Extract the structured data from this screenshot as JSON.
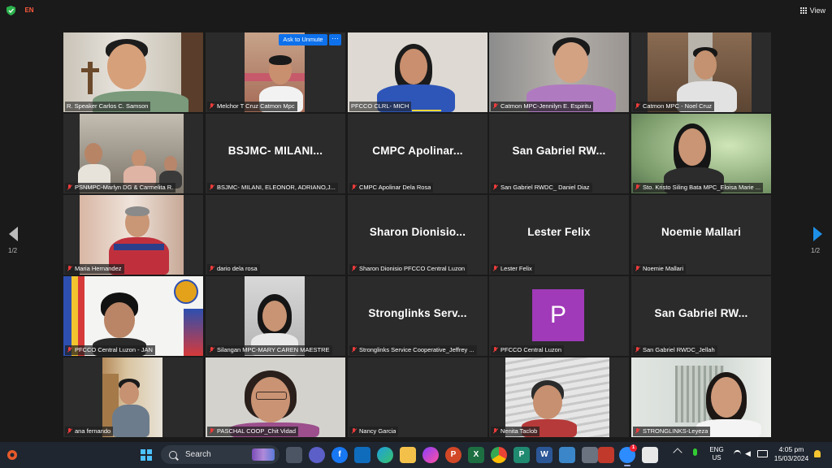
{
  "topbar": {
    "lang_badge": "EN",
    "view_label": "View",
    "icons": [
      "shield-check-icon",
      "grid-view-icon"
    ]
  },
  "meeting": {
    "ask_to_unmute": "Ask to Unmute",
    "more_options": "···",
    "page_left": "1/2",
    "page_right": "1/2",
    "tiles": [
      {
        "label": "R. Speaker Carlos C. Samson",
        "muted": false,
        "display_name": "",
        "video": true
      },
      {
        "label": "Melchor T Cruz Catmon Mpc",
        "muted": true,
        "display_name": "",
        "video": true
      },
      {
        "label": "PFCCO CLRL- MICH",
        "muted": false,
        "display_name": "",
        "video": true
      },
      {
        "label": "Catmon MPC-Jennilyn E. Espiritu",
        "muted": true,
        "display_name": "",
        "video": true
      },
      {
        "label": "Catmon MPC - Noel Cruz",
        "muted": true,
        "display_name": "",
        "video": true
      },
      {
        "label": "PSNMPC-Marlyn DG & Carmelita R.",
        "muted": true,
        "display_name": "",
        "video": true
      },
      {
        "label": "BSJMC- MILANI, ELEONOR, ADRIANO,J...",
        "muted": true,
        "display_name": "BSJMC-  MILANI...",
        "video": false
      },
      {
        "label": "CMPC Apolinar Dela Rosa",
        "muted": true,
        "display_name": "CMPC  Apolinar...",
        "video": false
      },
      {
        "label": "San Gabriel RWDC_ Daniel Diaz",
        "muted": true,
        "display_name": "San  Gabriel  RW...",
        "video": false
      },
      {
        "label": "Sto. Kristo Siling Bata MPC_Eloisa Marie ...",
        "muted": true,
        "display_name": "",
        "video": true
      },
      {
        "label": "Maria Hernandez",
        "muted": true,
        "display_name": "",
        "video": true
      },
      {
        "label": "dario dela rosa",
        "muted": true,
        "display_name": "",
        "video": false
      },
      {
        "label": "Sharon Dionisio PFCCO Central Luzon",
        "muted": true,
        "display_name": "Sharon  Dionisio...",
        "video": false
      },
      {
        "label": "Lester Felix",
        "muted": true,
        "display_name": "Lester Felix",
        "video": false
      },
      {
        "label": "Noemie Mallari",
        "muted": true,
        "display_name": "Noemie  Mallari",
        "video": false
      },
      {
        "label": "PFCCO Central Luzon - JAN",
        "muted": true,
        "display_name": "",
        "video": true
      },
      {
        "label": "Silangan MPC-MARY CAREN MAESTRE",
        "muted": true,
        "display_name": "",
        "video": true
      },
      {
        "label": "Stronglinks Service Cooperative_Jeffrey ...",
        "muted": true,
        "display_name": "Stronglinks  Serv...",
        "video": false
      },
      {
        "label": "PFCCO Central Luzon",
        "muted": true,
        "display_name": "",
        "video": false,
        "avatar": "P"
      },
      {
        "label": "San Gabriel RWDC_Jellah",
        "muted": true,
        "display_name": "San  Gabriel  RW...",
        "video": false
      },
      {
        "label": "ana fernando",
        "muted": true,
        "display_name": "",
        "video": true
      },
      {
        "label": "PASCHAL COOP_Chit Vidad",
        "muted": true,
        "display_name": "",
        "video": true
      },
      {
        "label": "Nancy Garcia",
        "muted": true,
        "display_name": "",
        "video": false
      },
      {
        "label": "Nenita Taclob",
        "muted": true,
        "display_name": "",
        "video": true
      },
      {
        "label": "STRONGLINKS-Leyeza",
        "muted": true,
        "display_name": "",
        "video": true
      }
    ]
  },
  "taskbar": {
    "search_label": "Search",
    "lang_line1": "ENG",
    "lang_line2": "US",
    "time": "4:05 pm",
    "date": "15/03/2024",
    "zoom_badge": "1"
  }
}
